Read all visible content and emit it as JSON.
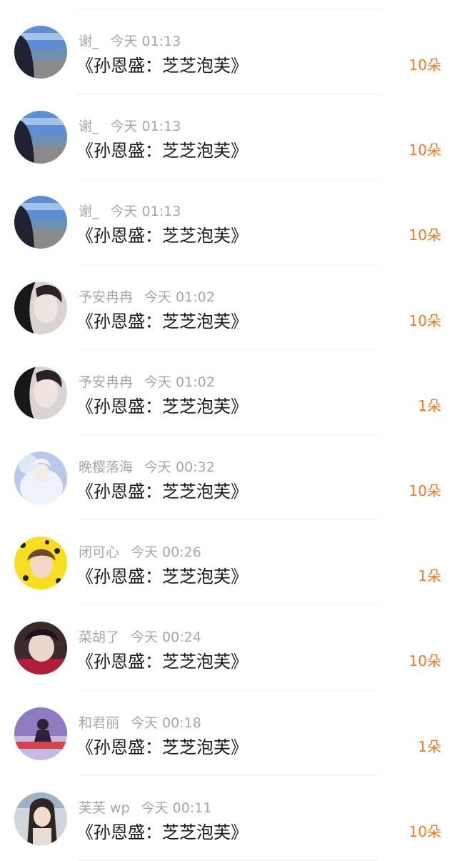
{
  "records": [
    {
      "user": "谢_",
      "time": "今天 01:13",
      "gift": "《孙恩盛：芝芝泡芙》",
      "count": "10朵",
      "avatar": "beach-avatar"
    },
    {
      "user": "谢_",
      "time": "今天 01:13",
      "gift": "《孙恩盛：芝芝泡芙》",
      "count": "10朵",
      "avatar": "beach-avatar"
    },
    {
      "user": "谢_",
      "time": "今天 01:13",
      "gift": "《孙恩盛：芝芝泡芙》",
      "count": "10朵",
      "avatar": "beach-avatar"
    },
    {
      "user": "予安冉冉",
      "time": "今天 01:02",
      "gift": "《孙恩盛：芝芝泡芙》",
      "count": "10朵",
      "avatar": "portrait-dark-avatar"
    },
    {
      "user": "予安冉冉",
      "time": "今天 01:02",
      "gift": "《孙恩盛：芝芝泡芙》",
      "count": "1朵",
      "avatar": "portrait-dark-avatar"
    },
    {
      "user": "晚樱落海",
      "time": "今天 00:32",
      "gift": "《孙恩盛：芝芝泡芙》",
      "count": "10朵",
      "avatar": "fantasy-white-avatar"
    },
    {
      "user": "闭可心",
      "time": "今天 00:26",
      "gift": "《孙恩盛：芝芝泡芙》",
      "count": "1朵",
      "avatar": "yellow-pattern-avatar"
    },
    {
      "user": "菜胡了",
      "time": "今天 00:24",
      "gift": "《孙恩盛：芝芝泡芙》",
      "count": "10朵",
      "avatar": "portrait-red-avatar"
    },
    {
      "user": "和君丽",
      "time": "今天 00:18",
      "gift": "《孙恩盛：芝芝泡芙》",
      "count": "1朵",
      "avatar": "purple-silhouette-avatar"
    },
    {
      "user": "芙芙 wp",
      "time": "今天 00:11",
      "gift": "《孙恩盛：芝芝泡芙》",
      "count": "10朵",
      "avatar": "car-selfie-avatar"
    }
  ],
  "colors": {
    "count": "#f27a22",
    "meta": "#a6a6a6",
    "gift": "#1a1a1a"
  }
}
